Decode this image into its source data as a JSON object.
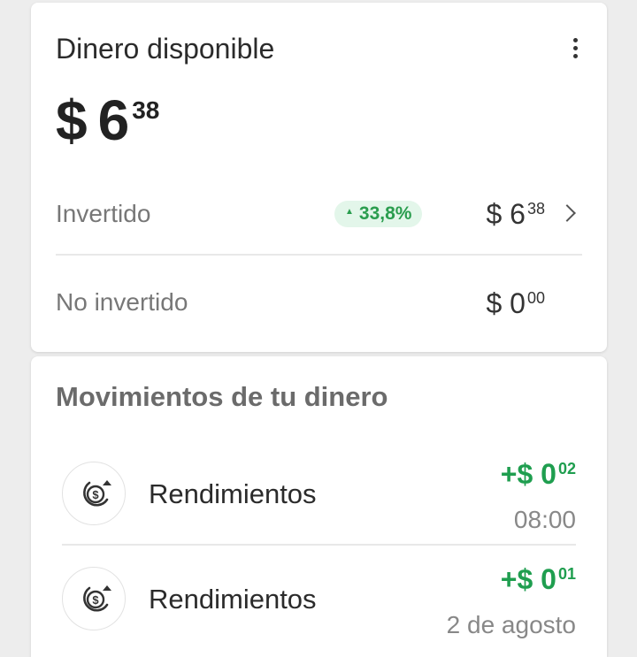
{
  "balance_card": {
    "title": "Dinero disponible",
    "menu_icon": "more-vertical-icon",
    "balance": {
      "currency": "$",
      "integer": "6",
      "decimal": "38"
    },
    "invested": {
      "label": "Invertido",
      "badge": "33,8%",
      "badge_icon": "triangle-up-icon",
      "amount": {
        "currency": "$",
        "integer": "6",
        "decimal": "38"
      }
    },
    "not_invested": {
      "label": "No invertido",
      "amount": {
        "currency": "$",
        "integer": "0",
        "decimal": "00"
      }
    }
  },
  "movements": {
    "title": "Movimientos de tu dinero",
    "items": [
      {
        "label": "Rendimientos",
        "sign": "+",
        "currency": "$",
        "integer": "0",
        "decimal": "02",
        "time": "08:00",
        "icon": "yield-coin-icon"
      },
      {
        "label": "Rendimientos",
        "sign": "+",
        "currency": "$",
        "integer": "0",
        "decimal": "01",
        "time": "2 de agosto",
        "icon": "yield-coin-icon"
      }
    ]
  },
  "colors": {
    "positive": "#1f9e4f",
    "badge_bg": "#e3f6ea",
    "page_bg": "#ededed"
  }
}
